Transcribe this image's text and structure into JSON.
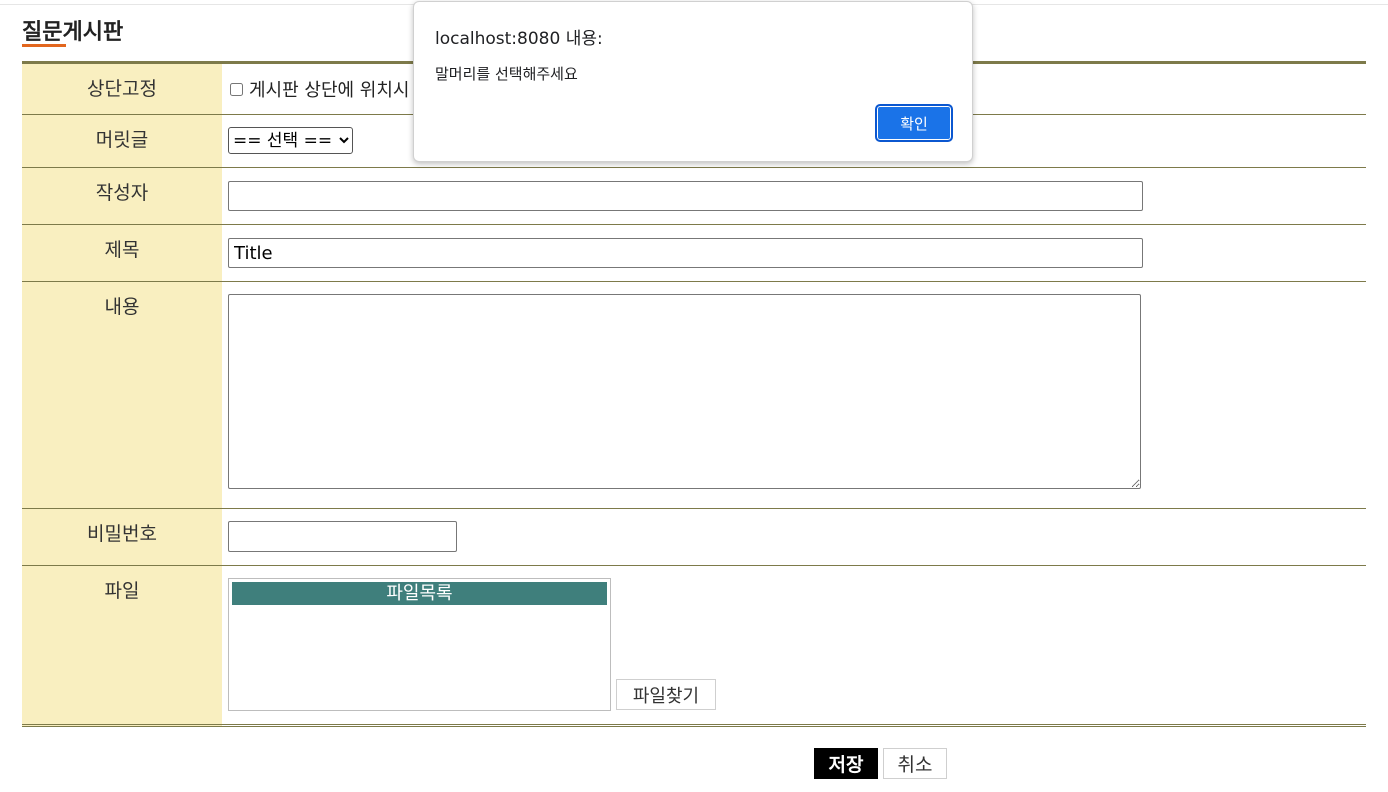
{
  "page": {
    "title": "질문게시판",
    "accent_color": "#e2661e",
    "border_color": "#7d7a4a",
    "label_bg": "#f9efc0"
  },
  "form": {
    "pin": {
      "label": "상단고정",
      "checkbox_text": "게시판 상단에 위치시"
    },
    "head": {
      "label": "머릿글",
      "selected": "== 선택 =="
    },
    "writer": {
      "label": "작성자",
      "value": ""
    },
    "subject": {
      "label": "제목",
      "value": "Title"
    },
    "content": {
      "label": "내용",
      "value": ""
    },
    "password": {
      "label": "비밀번호",
      "value": ""
    },
    "file": {
      "label": "파일",
      "list_header": "파일목록",
      "find_button": "파일찾기",
      "header_color": "#3f7f7c"
    }
  },
  "actions": {
    "save": "저장",
    "cancel": "취소"
  },
  "dialog": {
    "origin": "localhost:8080 내용:",
    "message": "말머리를 선택해주세요",
    "ok": "확인",
    "ok_color": "#1a73e8"
  }
}
